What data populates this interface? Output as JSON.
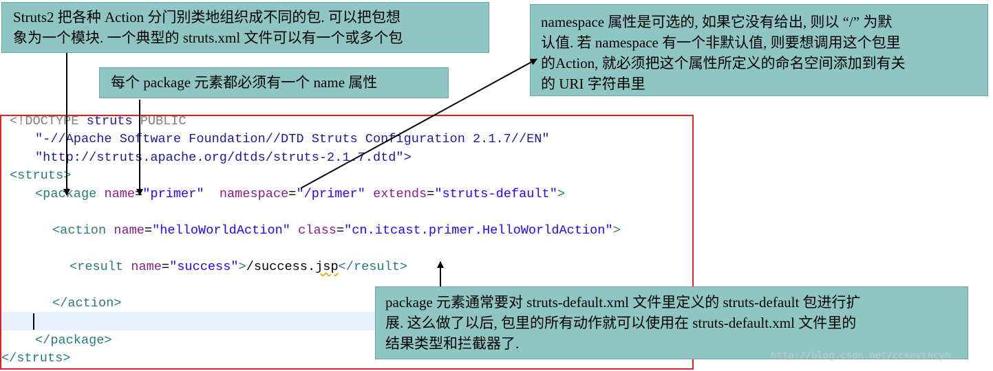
{
  "callouts": {
    "packages": {
      "line1": "Struts2 把各种 Action 分门别类地组织成不同的包. 可以把包想",
      "line2": "象为一个模块. 一个典型的 struts.xml 文件可以有一个或多个包"
    },
    "name_attr": {
      "line1": "每个 package 元素都必须有一个 name 属性"
    },
    "namespace": {
      "line1": "namespace 属性是可选的, 如果它没有给出, 则以 “/” 为默",
      "line2": "认值. 若 namespace 有一个非默认值, 则要想调用这个包里",
      "line3": "的Action, 就必须把这个属性所定义的命名空间添加到有关",
      "line4": "的 URI 字符串里"
    },
    "extends": {
      "line1": "package 元素通常要对 struts-default.xml 文件里定义的 struts-default 包进行扩",
      "line2": "展. 这么做了以后, 包里的所有动作就可以使用在 struts-default.xml 文件里的",
      "line3": "结果类型和拦截器了."
    }
  },
  "code": {
    "doctype_open": "<!DOCTYPE",
    "doctype_name": "struts",
    "doctype_public": "PUBLIC",
    "public_id": "\"-//Apache Software Foundation//DTD Struts Configuration 2.1.7//EN\"",
    "dtd_url": "\"http://struts.apache.org/dtds/struts-2.1.7.dtd\">",
    "struts_open": "<struts>",
    "package_tag": "<package",
    "attr_name": "name",
    "val_primer": "\"primer\"",
    "attr_namespace": "namespace",
    "val_namespace": "\"/primer\"",
    "attr_extends": "extends",
    "val_extends": "\"struts-default\"",
    "tag_close": ">",
    "action_tag": "<action",
    "val_action_name": "\"helloWorldAction\"",
    "attr_class": "class",
    "val_class": "\"cn.itcast.primer.HelloWorldAction\"",
    "result_tag": "<result",
    "val_result_name": "\"success\"",
    "result_text_a": "/success.",
    "result_text_b": "jsp",
    "result_close": "</result>",
    "action_close": "</action>",
    "package_close": "</package>",
    "struts_close": "</struts>",
    "equals": "="
  },
  "watermark": "http://blog.csdn.net/cckevincyh",
  "colors": {
    "callout_fill": "#8fc6c3",
    "frame_border": "#e51f23",
    "tag": "#277a7f",
    "attribute": "#8a1d8a",
    "value": "#2a00ff",
    "doctype": "#7f7f7f"
  }
}
